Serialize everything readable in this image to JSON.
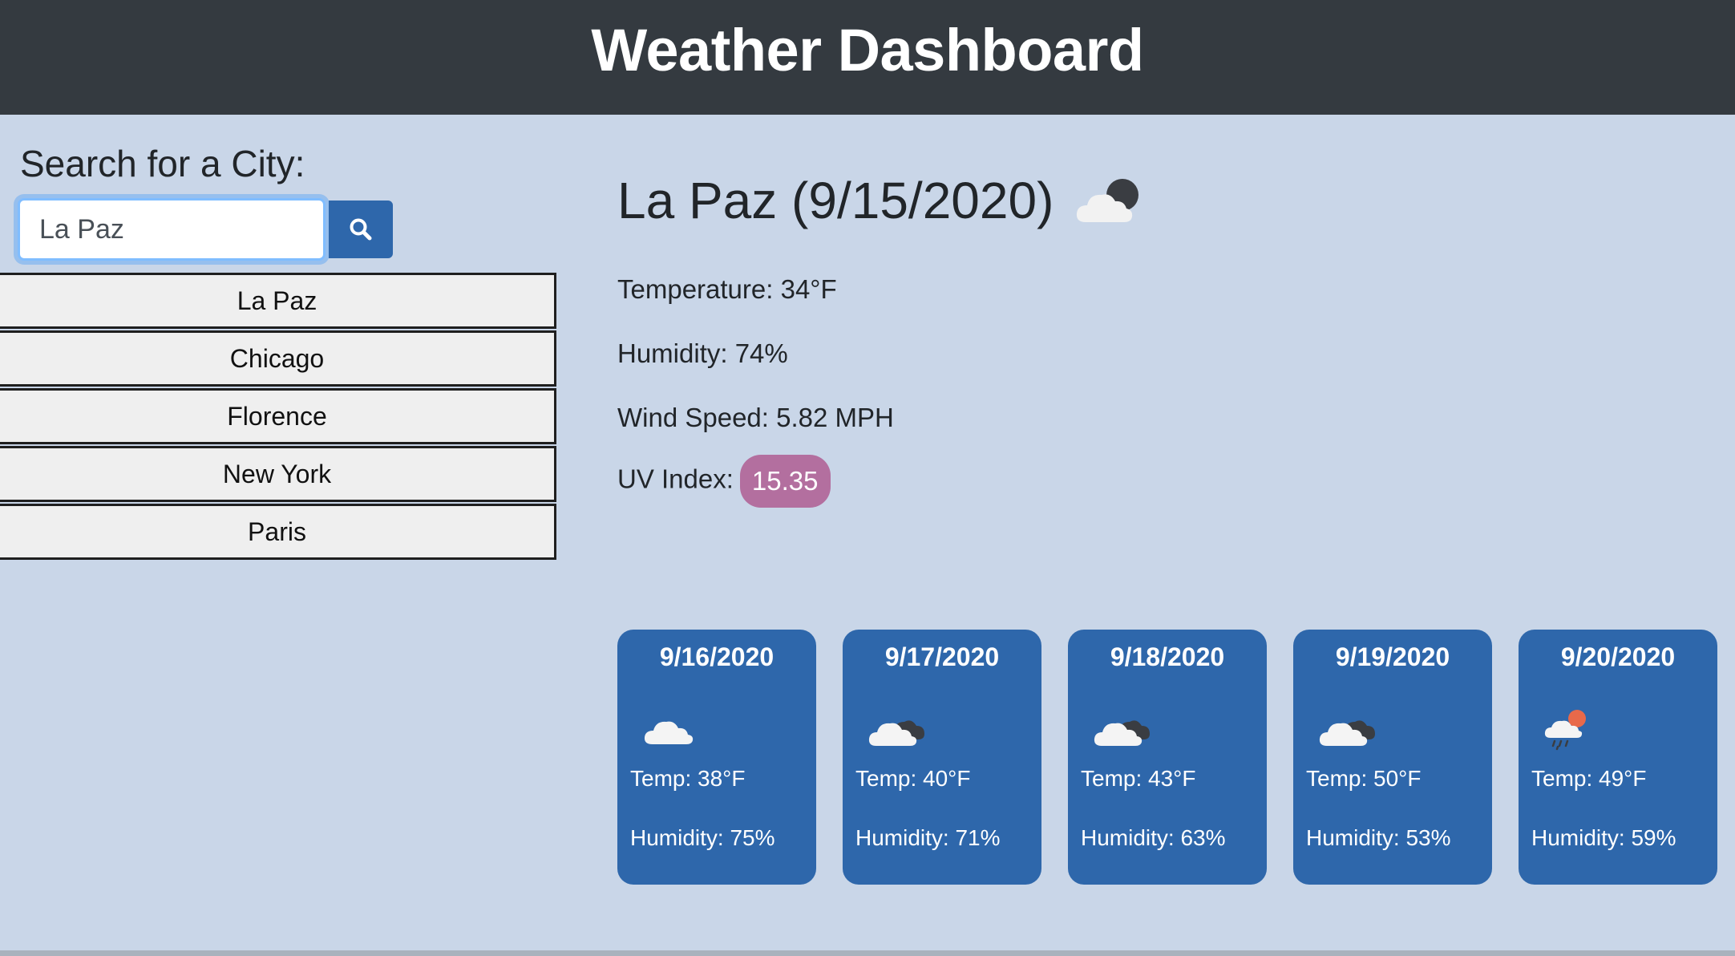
{
  "header": {
    "title": "Weather Dashboard"
  },
  "search": {
    "heading": "Search for a City:",
    "value": "La Paz",
    "button_icon": "search-icon"
  },
  "history": {
    "items": [
      "La Paz",
      "Chicago",
      "Florence",
      "New York",
      "Paris"
    ]
  },
  "current": {
    "title": "La Paz (9/15/2020)",
    "icon": "partly-cloudy-night-icon",
    "temperature": "Temperature: 34°F",
    "humidity": "Humidity: 74%",
    "wind": "Wind Speed: 5.82 MPH",
    "uv_label": "UV Index:",
    "uv_value": "15.35",
    "uv_color": "#b36f9f"
  },
  "forecast": [
    {
      "date": "9/16/2020",
      "icon": "cloud-icon",
      "temp": "Temp: 38°F",
      "humidity": "Humidity: 75%"
    },
    {
      "date": "9/17/2020",
      "icon": "broken-clouds-icon",
      "temp": "Temp: 40°F",
      "humidity": "Humidity: 71%"
    },
    {
      "date": "9/18/2020",
      "icon": "broken-clouds-icon",
      "temp": "Temp: 43°F",
      "humidity": "Humidity: 63%"
    },
    {
      "date": "9/19/2020",
      "icon": "broken-clouds-icon",
      "temp": "Temp: 50°F",
      "humidity": "Humidity: 53%"
    },
    {
      "date": "9/20/2020",
      "icon": "rain-sun-icon",
      "temp": "Temp: 49°F",
      "humidity": "Humidity: 59%"
    }
  ],
  "colors": {
    "header_bg": "#343a40",
    "page_bg": "#c9d6e8",
    "accent": "#2e67ab"
  }
}
